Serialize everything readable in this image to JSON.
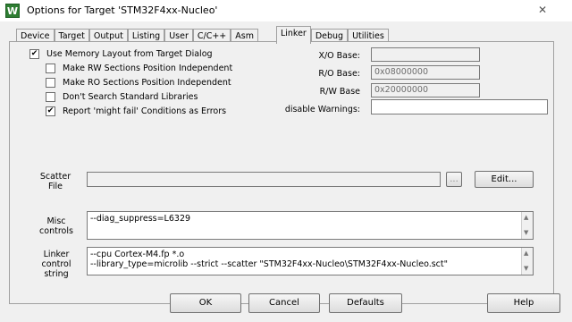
{
  "window": {
    "title": "Options for Target 'STM32F4xx-Nucleo'",
    "close_glyph": "✕",
    "icon_letter": "W"
  },
  "tabs": [
    {
      "label": "Device"
    },
    {
      "label": "Target"
    },
    {
      "label": "Output"
    },
    {
      "label": "Listing"
    },
    {
      "label": "User"
    },
    {
      "label": "C/C++"
    },
    {
      "label": "Asm"
    },
    {
      "label": "Linker",
      "active": true
    },
    {
      "label": "Debug"
    },
    {
      "label": "Utilities"
    }
  ],
  "linker": {
    "use_memory_layout": {
      "label": "Use Memory Layout from Target Dialog",
      "checked": true
    },
    "rw_independent": {
      "label": "Make RW Sections Position Independent",
      "checked": false
    },
    "ro_independent": {
      "label": "Make RO Sections Position Independent",
      "checked": false
    },
    "dont_search_libs": {
      "label": "Don't Search Standard Libraries",
      "checked": false
    },
    "report_might_fail": {
      "label": "Report 'might fail' Conditions as Errors",
      "checked": true
    },
    "xo_base": {
      "label": "X/O Base:",
      "value": ""
    },
    "ro_base": {
      "label": "R/O Base:",
      "value": "0x08000000"
    },
    "rw_base": {
      "label": "R/W Base",
      "value": "0x20000000"
    },
    "disable_warnings": {
      "label": "disable Warnings:",
      "value": ""
    },
    "scatter_file": {
      "label_line1": "Scatter",
      "label_line2": "File",
      "value": "",
      "browse_label": "...",
      "edit_label": "Edit..."
    },
    "misc_controls": {
      "label_line1": "Misc",
      "label_line2": "controls",
      "value": "--diag_suppress=L6329"
    },
    "linker_control": {
      "label_line1": "Linker",
      "label_line2": "control",
      "label_line3": "string",
      "line1": "--cpu Cortex-M4.fp *.o",
      "line2": "--library_type=microlib --strict --scatter \"STM32F4xx-Nucleo\\STM32F4xx-Nucleo.sct\""
    }
  },
  "buttons": {
    "ok": "OK",
    "cancel": "Cancel",
    "defaults": "Defaults",
    "help": "Help"
  },
  "check_glyph": "✔"
}
